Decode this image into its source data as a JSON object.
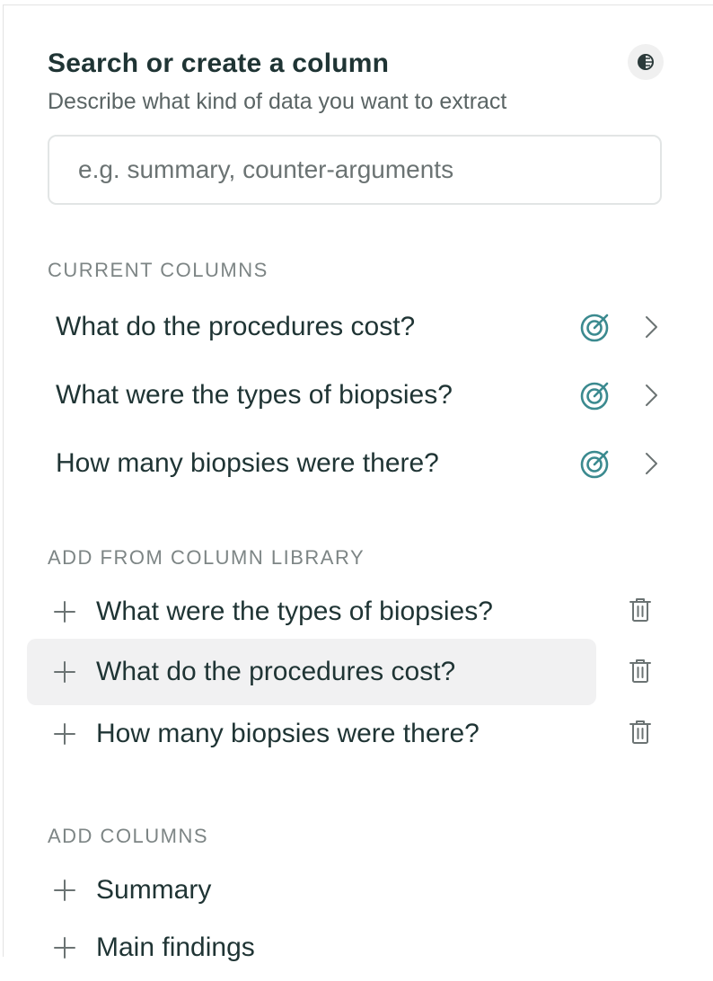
{
  "header": {
    "title": "Search or create a column",
    "subtitle": "Describe what kind of data you want to extract",
    "icon": "contrast-icon"
  },
  "search": {
    "placeholder": "e.g. summary, counter-arguments",
    "value": ""
  },
  "current_columns": {
    "heading": "CURRENT COLUMNS",
    "items": [
      {
        "label": "What do the procedures cost?"
      },
      {
        "label": "What were the types of biopsies?"
      },
      {
        "label": "How many biopsies were there?"
      }
    ]
  },
  "library": {
    "heading": "ADD FROM COLUMN LIBRARY",
    "items": [
      {
        "label": "What were the types of biopsies?"
      },
      {
        "label": "What do the procedures cost?",
        "highlighted": true
      },
      {
        "label": "How many biopsies were there?"
      }
    ]
  },
  "add_columns": {
    "heading": "ADD COLUMNS",
    "items": [
      {
        "label": "Summary"
      },
      {
        "label": "Main findings"
      }
    ]
  },
  "colors": {
    "accent": "#3b8a8f",
    "text": "#1f3434",
    "muted": "#7d8585",
    "highlight": "#f1f1f2"
  }
}
